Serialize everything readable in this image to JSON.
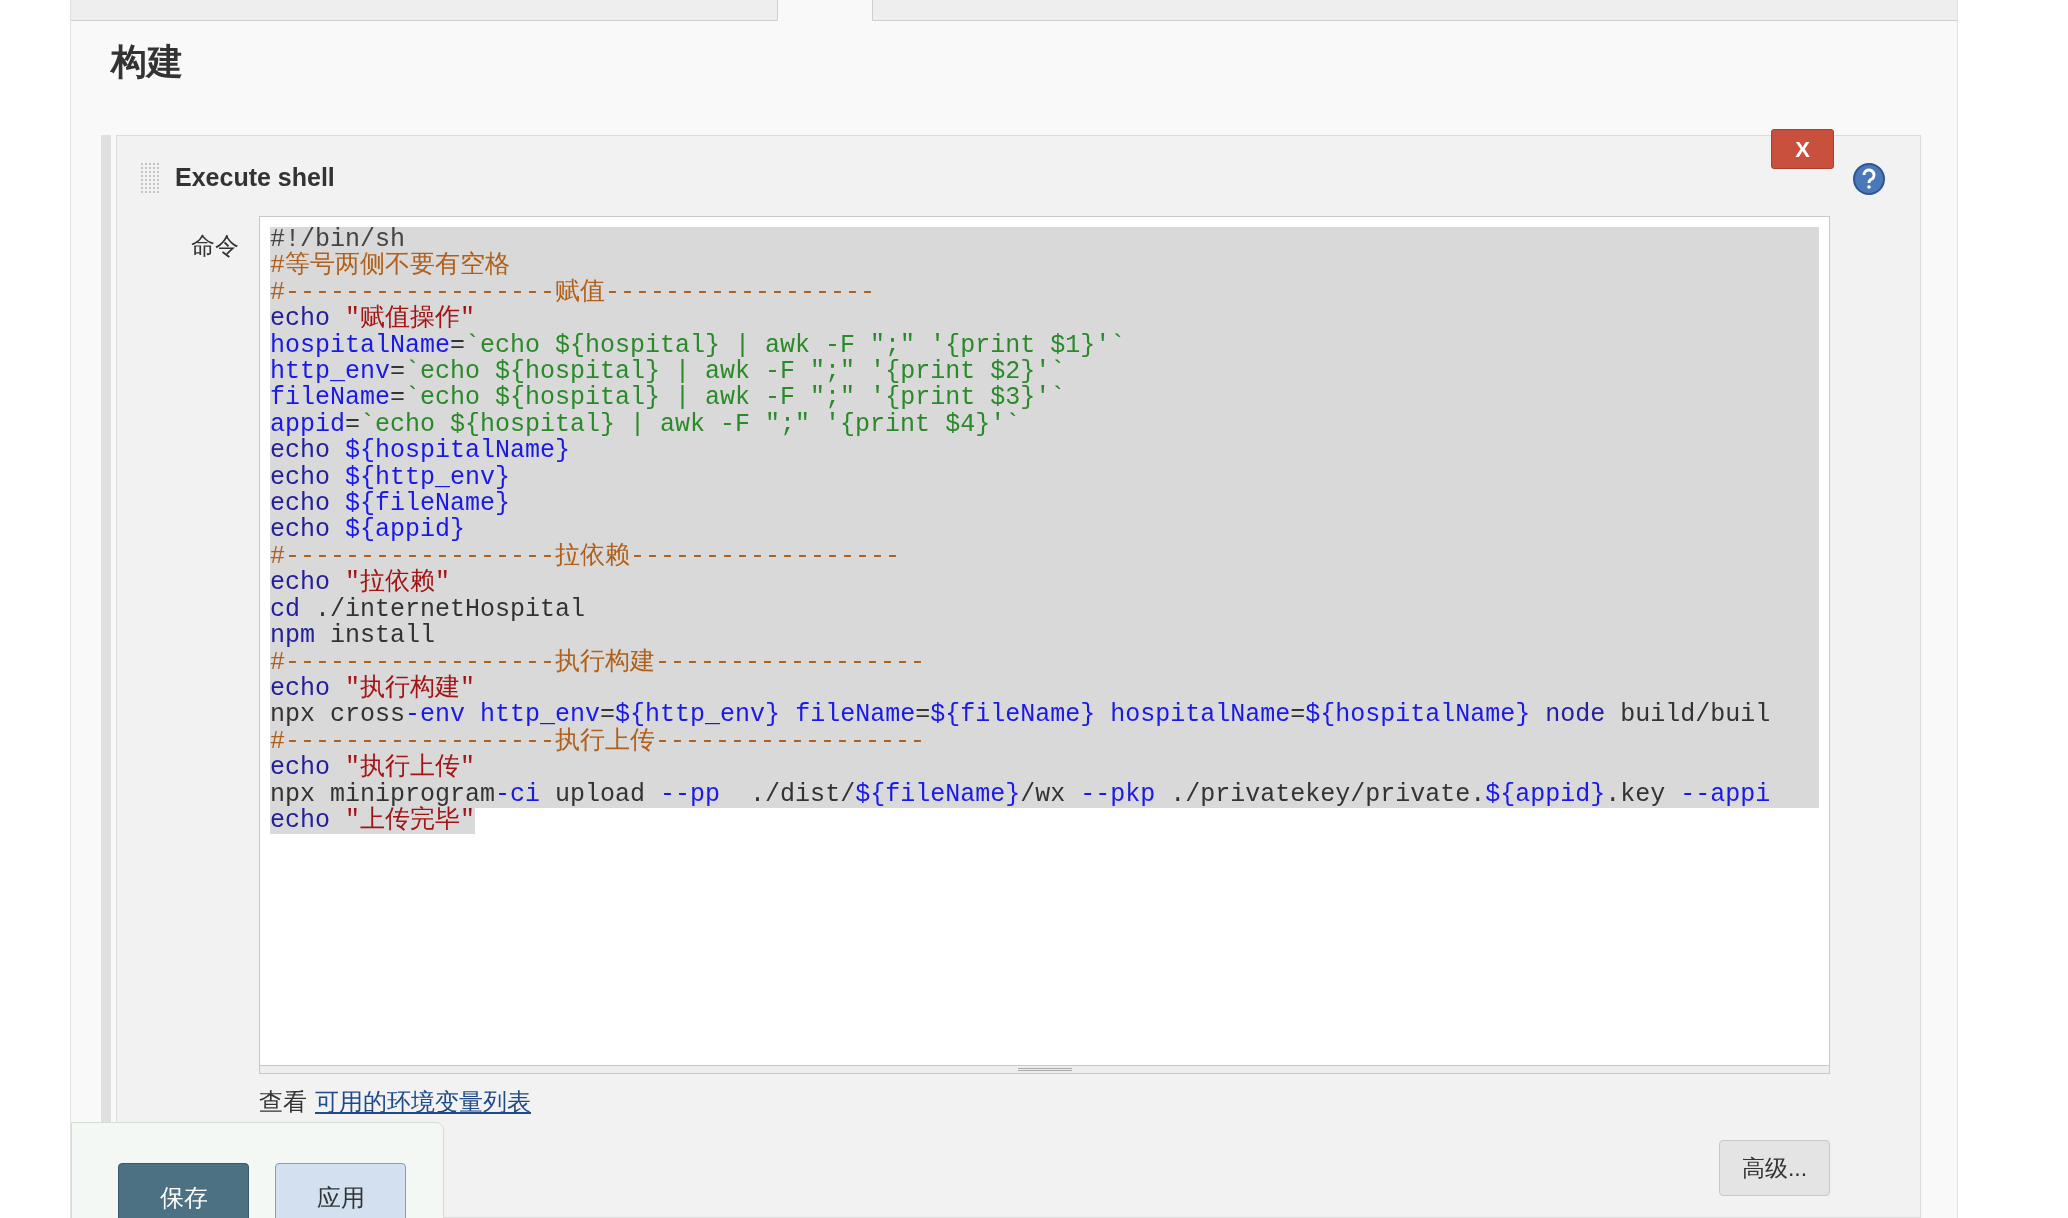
{
  "section_title": "构建",
  "step": {
    "title": "Execute shell",
    "delete_button": "X",
    "field_label": "命令",
    "code_lines": [
      [
        {
          "kind": "meta",
          "text": "#!/bin/sh"
        }
      ],
      [
        {
          "kind": "comment",
          "text": "#等号两侧不要有空格"
        }
      ],
      [
        {
          "kind": "comment",
          "text": "#------------------赋值------------------"
        }
      ],
      [
        {
          "kind": "builtin",
          "text": "echo "
        },
        {
          "kind": "string",
          "text": "\"赋值操作\""
        }
      ],
      [
        {
          "kind": "def",
          "text": "hospitalName"
        },
        {
          "kind": "plain",
          "text": "="
        },
        {
          "kind": "backtick",
          "text": "`echo ${hospital} | awk -F \";\" '{print $1}'`"
        }
      ],
      [
        {
          "kind": "def",
          "text": "http_env"
        },
        {
          "kind": "plain",
          "text": "="
        },
        {
          "kind": "backtick",
          "text": "`echo ${hospital} | awk -F \";\" '{print $2}'`"
        }
      ],
      [
        {
          "kind": "def",
          "text": "fileName"
        },
        {
          "kind": "plain",
          "text": "="
        },
        {
          "kind": "backtick",
          "text": "`echo ${hospital} | awk -F \";\" '{print $3}'`"
        }
      ],
      [
        {
          "kind": "def",
          "text": "appid"
        },
        {
          "kind": "plain",
          "text": "="
        },
        {
          "kind": "backtick",
          "text": "`echo ${hospital} | awk -F \";\" '{print $4}'`"
        }
      ],
      [
        {
          "kind": "builtin",
          "text": "echo "
        },
        {
          "kind": "var",
          "text": "${hospitalName}"
        }
      ],
      [
        {
          "kind": "builtin",
          "text": "echo "
        },
        {
          "kind": "var",
          "text": "${http_env}"
        }
      ],
      [
        {
          "kind": "builtin",
          "text": "echo "
        },
        {
          "kind": "var",
          "text": "${fileName}"
        }
      ],
      [
        {
          "kind": "builtin",
          "text": "echo "
        },
        {
          "kind": "var",
          "text": "${appid}"
        }
      ],
      [
        {
          "kind": "comment",
          "text": "#------------------拉依赖------------------"
        }
      ],
      [
        {
          "kind": "builtin",
          "text": "echo "
        },
        {
          "kind": "string",
          "text": "\"拉依赖\""
        }
      ],
      [
        {
          "kind": "builtin",
          "text": "cd"
        },
        {
          "kind": "plain",
          "text": " ./internetHospital"
        }
      ],
      [
        {
          "kind": "builtin",
          "text": "npm"
        },
        {
          "kind": "plain",
          "text": " install"
        }
      ],
      [
        {
          "kind": "comment",
          "text": "#------------------执行构建------------------"
        }
      ],
      [
        {
          "kind": "builtin",
          "text": "echo "
        },
        {
          "kind": "string",
          "text": "\"执行构建\""
        }
      ],
      [
        {
          "kind": "plain",
          "text": "npx cross"
        },
        {
          "kind": "def",
          "text": "-env http_env"
        },
        {
          "kind": "plain",
          "text": "="
        },
        {
          "kind": "var",
          "text": "${http_env} "
        },
        {
          "kind": "def",
          "text": "fileName"
        },
        {
          "kind": "plain",
          "text": "="
        },
        {
          "kind": "var",
          "text": "${fileName} "
        },
        {
          "kind": "def",
          "text": "hospitalName"
        },
        {
          "kind": "plain",
          "text": "="
        },
        {
          "kind": "var",
          "text": "${hospitalName} "
        },
        {
          "kind": "builtin",
          "text": "node"
        },
        {
          "kind": "plain",
          "text": " build/buil"
        }
      ],
      [
        {
          "kind": "comment",
          "text": "#------------------执行上传------------------"
        }
      ],
      [
        {
          "kind": "builtin",
          "text": "echo "
        },
        {
          "kind": "string",
          "text": "\"执行上传\""
        }
      ],
      [
        {
          "kind": "plain",
          "text": "npx miniprogram"
        },
        {
          "kind": "def",
          "text": "-ci"
        },
        {
          "kind": "plain",
          "text": " upload "
        },
        {
          "kind": "def",
          "text": "--pp"
        },
        {
          "kind": "plain",
          "text": "  ./dist/"
        },
        {
          "kind": "var",
          "text": "${fileName}"
        },
        {
          "kind": "plain",
          "text": "/wx "
        },
        {
          "kind": "def",
          "text": "--pkp"
        },
        {
          "kind": "plain",
          "text": " ./privatekey/private."
        },
        {
          "kind": "var",
          "text": "${appid}"
        },
        {
          "kind": "plain",
          "text": ".key "
        },
        {
          "kind": "def",
          "text": "--appi"
        }
      ],
      [
        {
          "kind": "builtin",
          "text": "echo "
        },
        {
          "kind": "string",
          "text": "\"上传完毕\""
        }
      ]
    ],
    "hint_prefix": "查看",
    "hint_link": "可用的环境变量列表",
    "advanced_button": "高级..."
  },
  "footer_buttons": [
    {
      "label": "保存",
      "kind": "primary"
    },
    {
      "label": "应用",
      "kind": "secondary"
    }
  ]
}
